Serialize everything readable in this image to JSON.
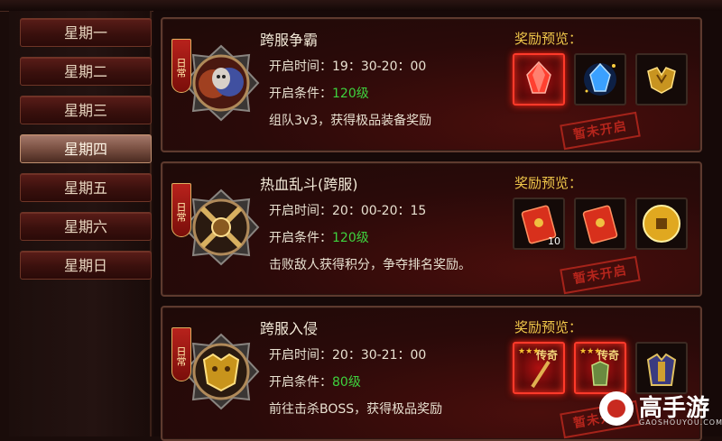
{
  "sidebar": {
    "items": [
      "星期一",
      "星期二",
      "星期三",
      "星期四",
      "星期五",
      "星期六",
      "星期日"
    ],
    "active_index": 3
  },
  "cards": [
    {
      "badge": "日常",
      "title": "跨服争霸",
      "time_label": "开启时间：19：30-20：00",
      "cond_prefix": "开启条件：",
      "cond_value": "120级",
      "desc": "组队3v3，获得极品装备奖励",
      "reward_label": "奖励预览：",
      "rewards": [
        {
          "icon": "red-crystal-icon",
          "count": "",
          "tag": ""
        },
        {
          "icon": "blue-crystal-icon",
          "count": "",
          "tag": ""
        },
        {
          "icon": "gold-armor-icon",
          "count": "",
          "tag": ""
        }
      ],
      "stamp": "暂未开启"
    },
    {
      "badge": "日常",
      "title": "热血乱斗(跨服)",
      "time_label": "开启时间：20：00-20：15",
      "cond_prefix": "开启条件：",
      "cond_value": "120级",
      "desc": "击败敌人获得积分，争夺排名奖励。",
      "reward_label": "奖励预览：",
      "rewards": [
        {
          "icon": "red-envelope-icon",
          "count": "10",
          "tag": ""
        },
        {
          "icon": "red-envelope-icon",
          "count": "",
          "tag": ""
        },
        {
          "icon": "gold-coin-icon",
          "count": "",
          "tag": ""
        }
      ],
      "stamp": "暂未开启"
    },
    {
      "badge": "日常",
      "title": "跨服入侵",
      "time_label": "开启时间：20：30-21：00",
      "cond_prefix": "开启条件：",
      "cond_value": "80级",
      "desc": "前往击杀BOSS，获得极品奖励",
      "reward_label": "奖励预览：",
      "rewards": [
        {
          "icon": "legend-weapon-icon",
          "count": "",
          "tag": "传奇"
        },
        {
          "icon": "legend-armor-icon",
          "count": "",
          "tag": "传奇"
        },
        {
          "icon": "warrior-armor-icon",
          "count": "",
          "tag": ""
        }
      ],
      "stamp": "暂未开启"
    }
  ],
  "watermark": {
    "text": "高手游",
    "sub": "GAOSHOUYOU.COM"
  },
  "colors": {
    "accent_gold": "#f0c74a",
    "level_green": "#3ed23e",
    "stamp_red": "#c2281e"
  }
}
